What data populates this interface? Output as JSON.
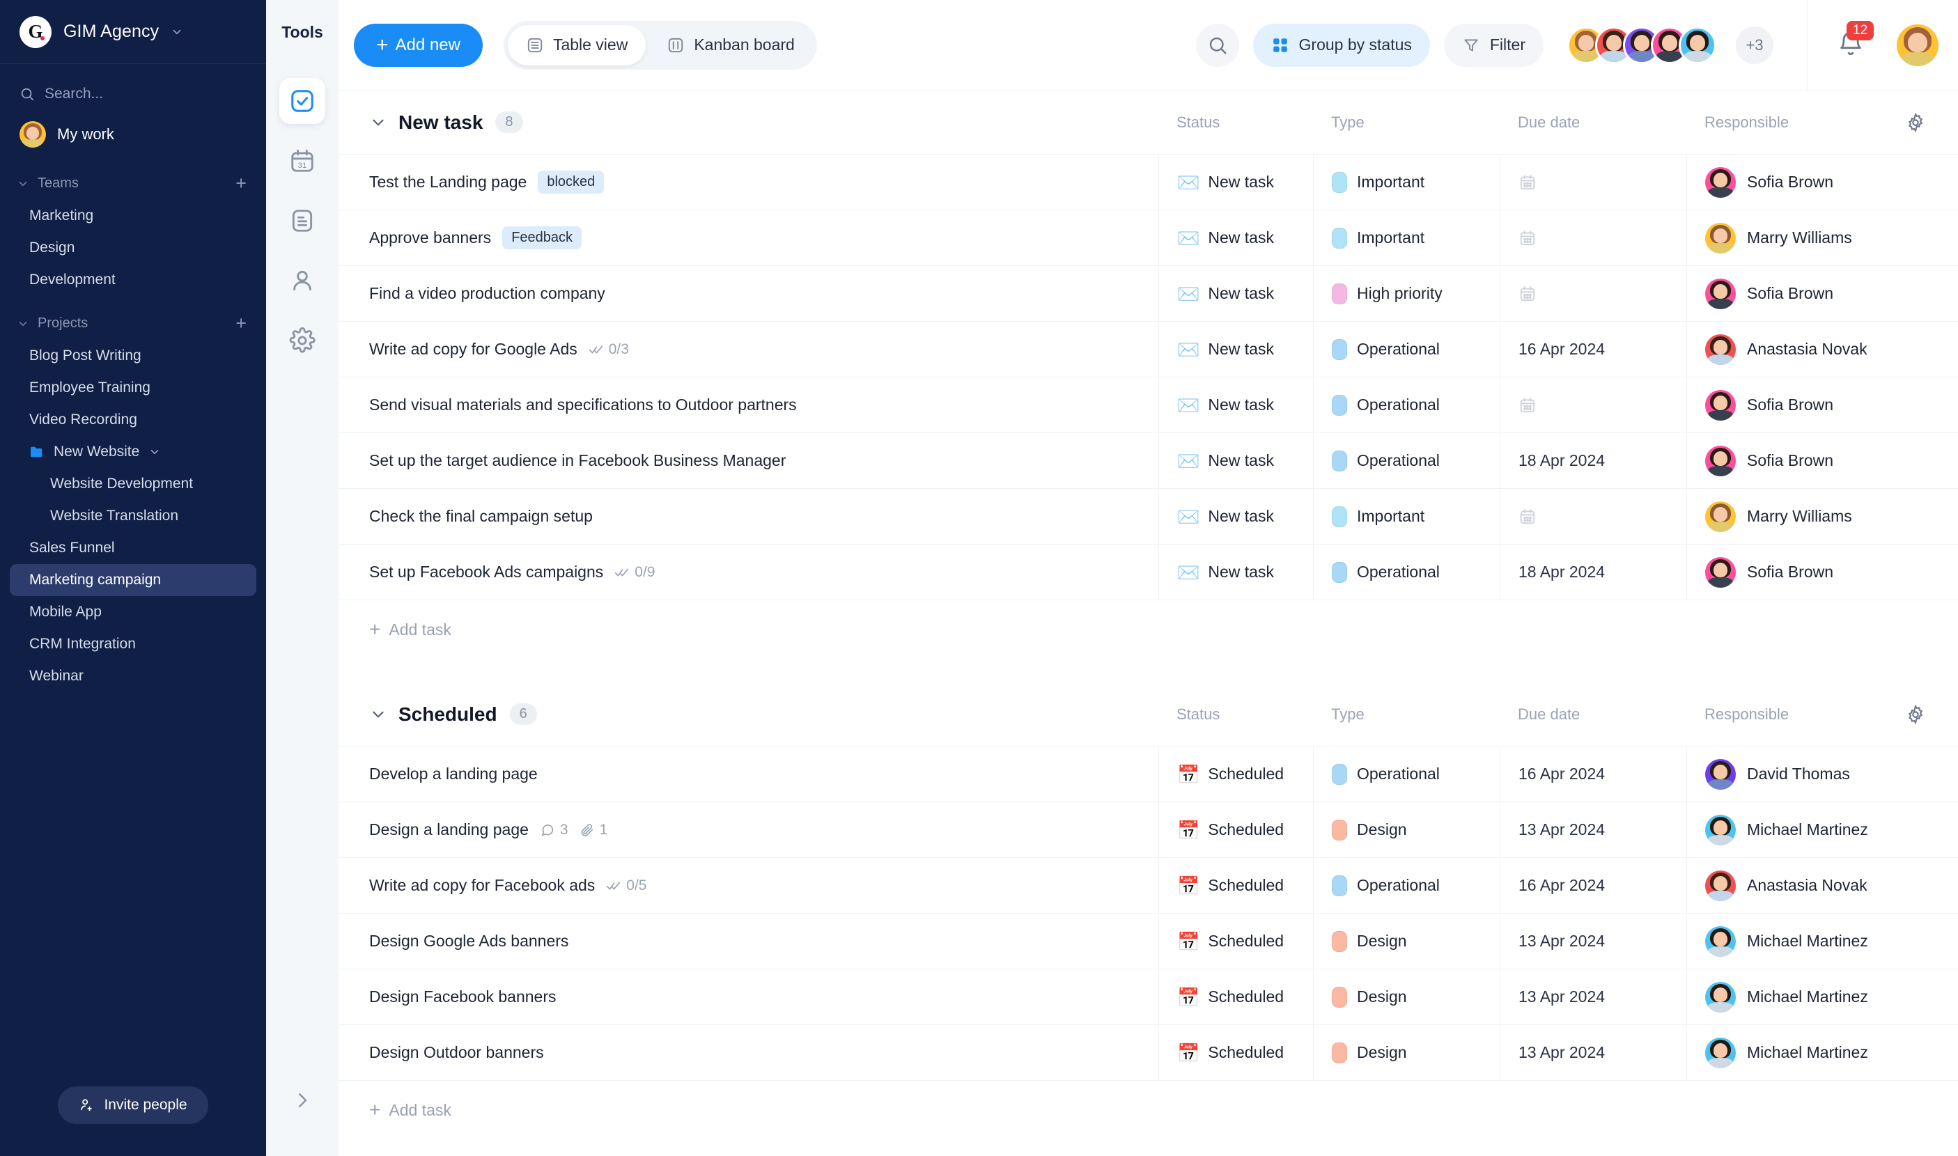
{
  "sidebar": {
    "brand": {
      "logo_letter": "G",
      "name": "GIM Agency"
    },
    "search_placeholder": "Search...",
    "my_work_label": "My work",
    "teams": {
      "label": "Teams",
      "add_label": "+",
      "items": [
        {
          "label": "Marketing"
        },
        {
          "label": "Design"
        },
        {
          "label": "Development"
        }
      ]
    },
    "projects": {
      "label": "Projects",
      "add_label": "+",
      "items": [
        {
          "label": "Blog Post Writing",
          "indent": false,
          "folder": false,
          "active": false
        },
        {
          "label": "Employee Training",
          "indent": false,
          "folder": false,
          "active": false
        },
        {
          "label": "Video Recording",
          "indent": false,
          "folder": false,
          "active": false
        },
        {
          "label": "New Website",
          "indent": false,
          "folder": true,
          "active": false
        },
        {
          "label": "Website Development",
          "indent": true,
          "folder": false,
          "active": false
        },
        {
          "label": "Website Translation",
          "indent": true,
          "folder": false,
          "active": false
        },
        {
          "label": "Sales Funnel",
          "indent": false,
          "folder": false,
          "active": false
        },
        {
          "label": "Marketing campaign",
          "indent": false,
          "folder": false,
          "active": true
        },
        {
          "label": "Mobile App",
          "indent": false,
          "folder": false,
          "active": false
        },
        {
          "label": "CRM Integration",
          "indent": false,
          "folder": false,
          "active": false
        },
        {
          "label": "Webinar",
          "indent": false,
          "folder": false,
          "active": false
        }
      ]
    },
    "invite_label": "Invite people"
  },
  "rail": {
    "title": "Tools",
    "items": [
      {
        "icon": "checkbox-icon",
        "active": true
      },
      {
        "icon": "calendar-icon",
        "active": false
      },
      {
        "icon": "document-icon",
        "active": false
      },
      {
        "icon": "person-icon",
        "active": false
      },
      {
        "icon": "gear-icon",
        "active": false
      }
    ]
  },
  "topbar": {
    "add_new_label": "Add new",
    "views": [
      {
        "label": "Table view",
        "icon": "table-icon",
        "active": true
      },
      {
        "label": "Kanban board",
        "icon": "kanban-icon",
        "active": false
      }
    ],
    "search_icon": "search-icon",
    "group_by_label": "Group by status",
    "filter_label": "Filter",
    "avatar_overflow": "+3",
    "notification_count": "12",
    "accent_color": "#1a8cf5"
  },
  "table": {
    "columns": [
      "Status",
      "Type",
      "Due date",
      "Responsible"
    ],
    "add_task_label": "Add task",
    "groups": [
      {
        "title": "New task",
        "count": "8",
        "rows": [
          {
            "name": "Test the Landing page",
            "chip": "blocked",
            "checklist": "",
            "comments": "",
            "attachments": "",
            "status": "New task",
            "status_icon": "envelope-icon",
            "type": "Important",
            "type_color": "#aee4f5",
            "due_date": "",
            "responsible": "Sofia Brown",
            "av_hair": "#2b1b16",
            "av_ring": "#ff4d9d",
            "av_body": "#37404e"
          },
          {
            "name": "Approve banners",
            "chip": "Feedback",
            "checklist": "",
            "comments": "",
            "attachments": "",
            "status": "New task",
            "status_icon": "envelope-icon",
            "type": "Important",
            "type_color": "#aee4f5",
            "due_date": "",
            "responsible": "Marry Williams",
            "av_hair": "#8a5a33",
            "av_ring": "#ffc233",
            "av_body": "#e3c969"
          },
          {
            "name": "Find a video production company",
            "chip": "",
            "checklist": "",
            "comments": "",
            "attachments": "",
            "status": "New task",
            "status_icon": "envelope-icon",
            "type": "High priority",
            "type_color": "#f3b9e4",
            "due_date": "",
            "responsible": "Sofia Brown",
            "av_hair": "#2b1b16",
            "av_ring": "#ff4d9d",
            "av_body": "#37404e"
          },
          {
            "name": "Write ad copy for Google Ads",
            "chip": "",
            "checklist": "0/3",
            "comments": "",
            "attachments": "",
            "status": "New task",
            "status_icon": "envelope-icon",
            "type": "Operational",
            "type_color": "#a9d8f7",
            "due_date": "16 Apr 2024",
            "responsible": "Anastasia Novak",
            "av_hair": "#3a2218",
            "av_ring": "#f0504f",
            "av_body": "#bfd6ec"
          },
          {
            "name": "Send visual materials and specifications to Outdoor partners",
            "chip": "",
            "checklist": "",
            "comments": "",
            "attachments": "",
            "status": "New task",
            "status_icon": "envelope-icon",
            "type": "Operational",
            "type_color": "#a9d8f7",
            "due_date": "",
            "responsible": "Sofia Brown",
            "av_hair": "#2b1b16",
            "av_ring": "#ff4d9d",
            "av_body": "#37404e"
          },
          {
            "name": "Set up the target audience in Facebook Business Manager",
            "chip": "",
            "checklist": "",
            "comments": "",
            "attachments": "",
            "status": "New task",
            "status_icon": "envelope-icon",
            "type": "Operational",
            "type_color": "#a9d8f7",
            "due_date": "18 Apr 2024",
            "responsible": "Sofia Brown",
            "av_hair": "#2b1b16",
            "av_ring": "#ff4d9d",
            "av_body": "#37404e"
          },
          {
            "name": "Check the final campaign setup",
            "chip": "",
            "checklist": "",
            "comments": "",
            "attachments": "",
            "status": "New task",
            "status_icon": "envelope-icon",
            "type": "Important",
            "type_color": "#aee4f5",
            "due_date": "",
            "responsible": "Marry Williams",
            "av_hair": "#8a5a33",
            "av_ring": "#ffc233",
            "av_body": "#e3c969"
          },
          {
            "name": "Set up Facebook Ads campaigns",
            "chip": "",
            "checklist": "0/9",
            "comments": "",
            "attachments": "",
            "status": "New task",
            "status_icon": "envelope-icon",
            "type": "Operational",
            "type_color": "#a9d8f7",
            "due_date": "18 Apr 2024",
            "responsible": "Sofia Brown",
            "av_hair": "#2b1b16",
            "av_ring": "#ff4d9d",
            "av_body": "#37404e"
          }
        ]
      },
      {
        "title": "Scheduled",
        "count": "6",
        "rows": [
          {
            "name": "Develop a landing page",
            "chip": "",
            "checklist": "",
            "comments": "",
            "attachments": "",
            "status": "Scheduled",
            "status_icon": "calendar-date-icon",
            "type": "Operational",
            "type_color": "#a9d8f7",
            "due_date": "16 Apr 2024",
            "responsible": "David Thomas",
            "av_hair": "#2a1d16",
            "av_ring": "#6b3df0",
            "av_body": "#6f86c9"
          },
          {
            "name": "Design a landing page",
            "chip": "",
            "checklist": "",
            "comments": "3",
            "attachments": "1",
            "status": "Scheduled",
            "status_icon": "calendar-date-icon",
            "type": "Design",
            "type_color": "#fbb9a3",
            "due_date": "13 Apr 2024",
            "responsible": "Michael Martinez",
            "av_hair": "#1f1a16",
            "av_ring": "#4ec3f0",
            "av_body": "#cfd9e6"
          },
          {
            "name": "Write ad copy for Facebook ads",
            "chip": "",
            "checklist": "0/5",
            "comments": "",
            "attachments": "",
            "status": "Scheduled",
            "status_icon": "calendar-date-icon",
            "type": "Operational",
            "type_color": "#a9d8f7",
            "due_date": "16 Apr 2024",
            "responsible": "Anastasia Novak",
            "av_hair": "#3a2218",
            "av_ring": "#f0504f",
            "av_body": "#bfd6ec"
          },
          {
            "name": "Design Google Ads banners",
            "chip": "",
            "checklist": "",
            "comments": "",
            "attachments": "",
            "status": "Scheduled",
            "status_icon": "calendar-date-icon",
            "type": "Design",
            "type_color": "#fbb9a3",
            "due_date": "13 Apr 2024",
            "responsible": "Michael Martinez",
            "av_hair": "#1f1a16",
            "av_ring": "#4ec3f0",
            "av_body": "#cfd9e6"
          },
          {
            "name": "Design Facebook banners",
            "chip": "",
            "checklist": "",
            "comments": "",
            "attachments": "",
            "status": "Scheduled",
            "status_icon": "calendar-date-icon",
            "type": "Design",
            "type_color": "#fbb9a3",
            "due_date": "13 Apr 2024",
            "responsible": "Michael Martinez",
            "av_hair": "#1f1a16",
            "av_ring": "#4ec3f0",
            "av_body": "#cfd9e6"
          },
          {
            "name": "Design Outdoor banners",
            "chip": "",
            "checklist": "",
            "comments": "",
            "attachments": "",
            "status": "Scheduled",
            "status_icon": "calendar-date-icon",
            "type": "Design",
            "type_color": "#fbb9a3",
            "due_date": "13 Apr 2024",
            "responsible": "Michael Martinez",
            "av_hair": "#1f1a16",
            "av_ring": "#4ec3f0",
            "av_body": "#cfd9e6"
          }
        ]
      }
    ]
  },
  "team_avatars": [
    {
      "ring": "#ffc233",
      "hair": "#a4623a",
      "body": "#e3c969"
    },
    {
      "ring": "#f0504f",
      "hair": "#3a2218",
      "body": "#bfd6ec"
    },
    {
      "ring": "#7a4df0",
      "hair": "#2a1d16",
      "body": "#6f86c9"
    },
    {
      "ring": "#ff4d9d",
      "hair": "#2b1b16",
      "body": "#37404e"
    },
    {
      "ring": "#4ec3f0",
      "hair": "#1f1a16",
      "body": "#cfd9e6"
    }
  ]
}
